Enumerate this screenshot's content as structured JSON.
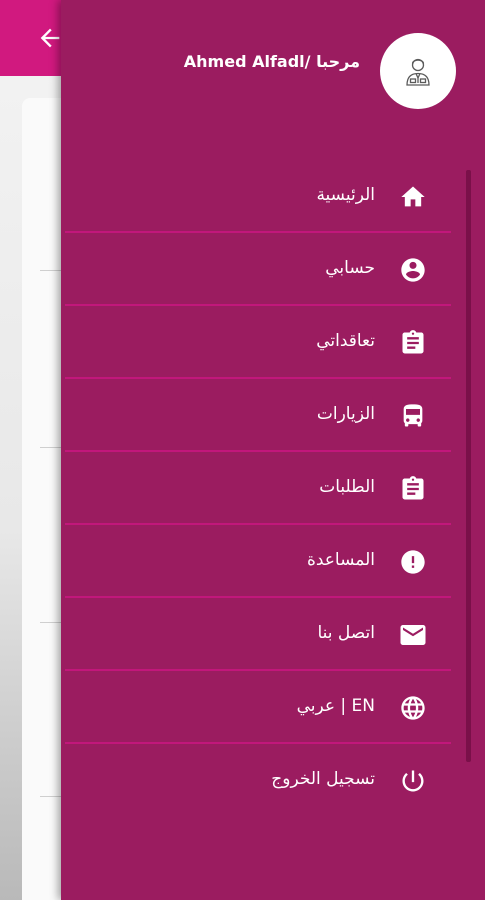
{
  "header": {
    "greeting": "Ahmed Alfadl/ مرحبا"
  },
  "icons": {
    "back": "arrow-left-icon",
    "avatar": "user-avatar-icon"
  },
  "colors": {
    "drawer_background": "#9b1c60",
    "app_bar": "#d1197f",
    "divider": "#c2177b",
    "text": "#ffffff"
  },
  "menu": [
    {
      "label": "الرئيسية",
      "icon": "home-icon"
    },
    {
      "label": "حسابي",
      "icon": "account-circle-icon"
    },
    {
      "label": "تعاقداتي",
      "icon": "clipboard-icon"
    },
    {
      "label": "الزيارات",
      "icon": "bus-icon"
    },
    {
      "label": "الطلبات",
      "icon": "clipboard-icon"
    },
    {
      "label": "المساعدة",
      "icon": "alert-circle-icon"
    },
    {
      "label": "اتصل بنا",
      "icon": "mail-icon"
    },
    {
      "label": "EN | عربي",
      "icon": "globe-icon"
    },
    {
      "label": "تسجيل الخروج",
      "icon": "power-icon"
    }
  ]
}
